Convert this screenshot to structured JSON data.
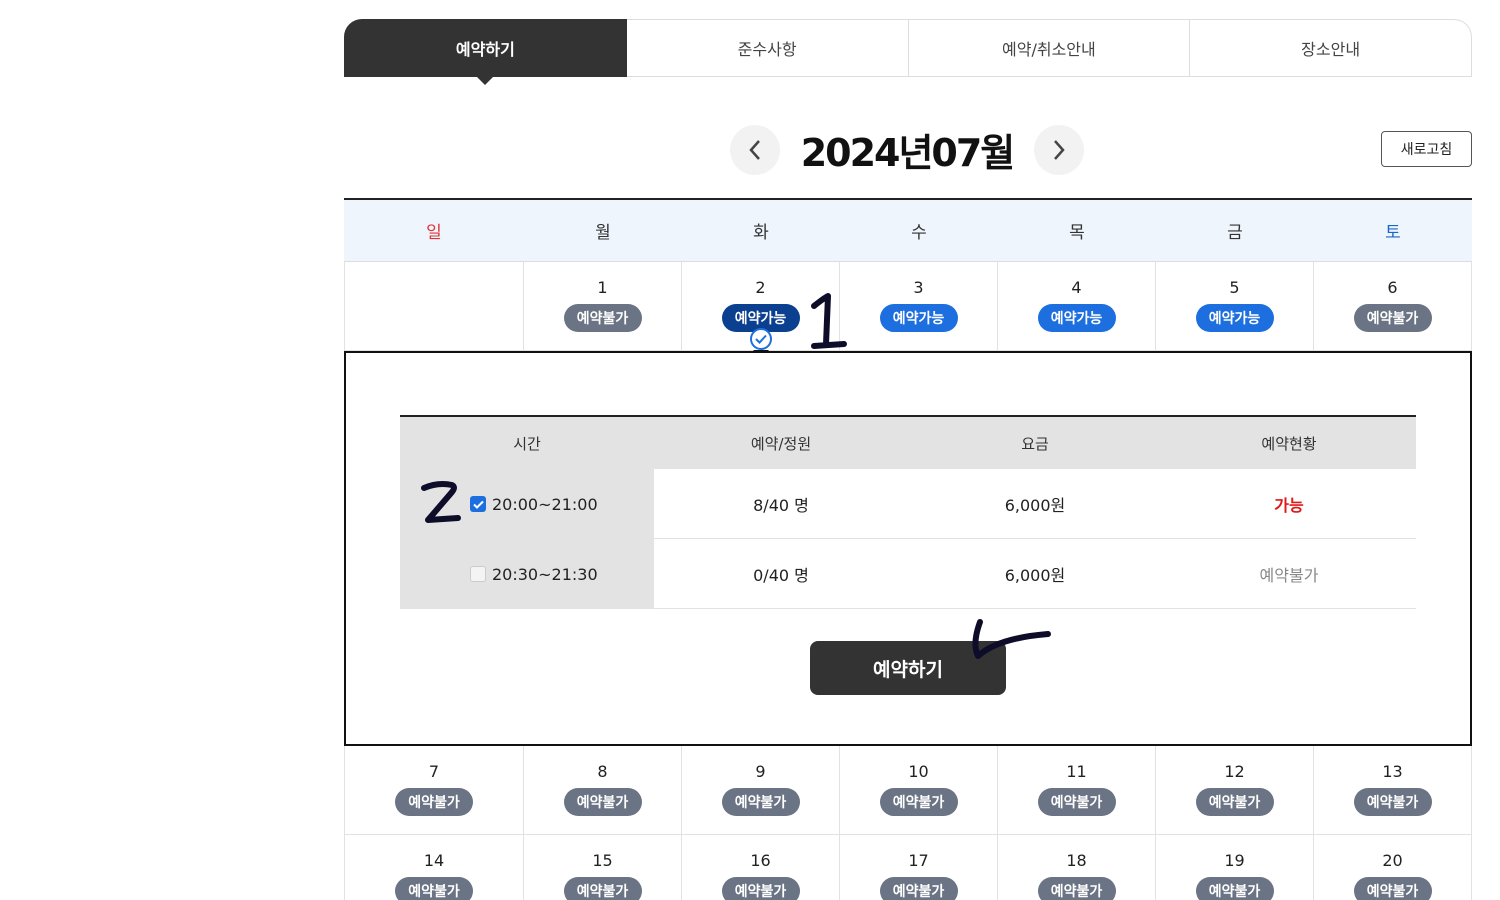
{
  "tabs": [
    {
      "label": "예약하기",
      "active": true
    },
    {
      "label": "준수사항",
      "active": false
    },
    {
      "label": "예약/취소안내",
      "active": false
    },
    {
      "label": "장소안내",
      "active": false
    }
  ],
  "calendar": {
    "month_title": "2024년07월",
    "refresh_label": "새로고침",
    "weekdays": [
      "일",
      "월",
      "화",
      "수",
      "목",
      "금",
      "토"
    ],
    "week1": {
      "d1": {
        "num": "1",
        "status": "예약불가"
      },
      "d2": {
        "num": "2",
        "status": "예약가능"
      },
      "d3": {
        "num": "3",
        "status": "예약가능"
      },
      "d4": {
        "num": "4",
        "status": "예약가능"
      },
      "d5": {
        "num": "5",
        "status": "예약가능"
      },
      "d6": {
        "num": "6",
        "status": "예약불가"
      }
    },
    "week2": {
      "d7": {
        "num": "7",
        "status": "예약불가"
      },
      "d8": {
        "num": "8",
        "status": "예약불가"
      },
      "d9": {
        "num": "9",
        "status": "예약불가"
      },
      "d10": {
        "num": "10",
        "status": "예약불가"
      },
      "d11": {
        "num": "11",
        "status": "예약불가"
      },
      "d12": {
        "num": "12",
        "status": "예약불가"
      },
      "d13": {
        "num": "13",
        "status": "예약불가"
      }
    },
    "week3": {
      "d14": {
        "num": "14",
        "status": "예약불가"
      },
      "d15": {
        "num": "15",
        "status": "예약불가"
      },
      "d16": {
        "num": "16",
        "status": "예약불가"
      },
      "d17": {
        "num": "17",
        "status": "예약불가"
      },
      "d18": {
        "num": "18",
        "status": "예약불가"
      },
      "d19": {
        "num": "19",
        "status": "예약불가"
      },
      "d20": {
        "num": "20",
        "status": "예약불가"
      }
    }
  },
  "slots": {
    "headers": [
      "시간",
      "예약/정원",
      "요금",
      "예약현황"
    ],
    "rows": [
      {
        "time": "20:00~21:00",
        "checked": true,
        "capacity": "8/40 명",
        "price": "6,000원",
        "status": "가능"
      },
      {
        "time": "20:30~21:30",
        "checked": false,
        "capacity": "0/40 명",
        "price": "6,000원",
        "status": "예약불가"
      }
    ],
    "submit_label": "예약하기"
  },
  "icons": {
    "prev": "chevron-left-icon",
    "next": "chevron-right-icon",
    "selected": "check-circle-icon"
  },
  "colors": {
    "available": "#1d6fe0",
    "selected": "#0b3f8f",
    "unavailable": "#6b7484",
    "status_ok": "#e01818"
  }
}
